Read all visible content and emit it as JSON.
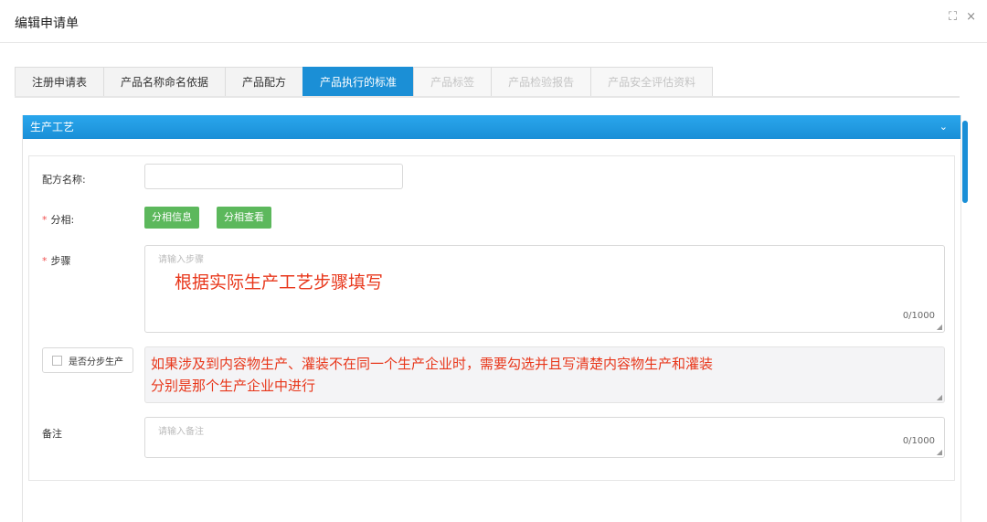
{
  "dialog": {
    "title": "编辑申请单",
    "fullscreen_icon": "⛶",
    "close_icon": "×"
  },
  "tabs": [
    {
      "label": "注册申请表",
      "state": "normal"
    },
    {
      "label": "产品名称命名依据",
      "state": "normal"
    },
    {
      "label": "产品配方",
      "state": "normal"
    },
    {
      "label": "产品执行的标准",
      "state": "active"
    },
    {
      "label": "产品标签",
      "state": "disabled"
    },
    {
      "label": "产品检验报告",
      "state": "disabled"
    },
    {
      "label": "产品安全评估资料",
      "state": "disabled"
    }
  ],
  "section": {
    "title": "生产工艺",
    "collapse_icon": "chevron-down-icon"
  },
  "form": {
    "formula_name_label": "配方名称:",
    "formula_name_value": "",
    "group_label": "分相:",
    "group_info_button": "分相信息",
    "group_view_button": "分相查看",
    "steps_label": "步骤",
    "steps_placeholder": "请输入步骤",
    "steps_counter": "0/1000",
    "split_checkbox_label": "是否分步生产",
    "notes_label": "备注",
    "notes_placeholder": "请输入备注",
    "notes_counter": "0/1000"
  },
  "annotations": {
    "steps_hint": "根据实际生产工艺步骤填写",
    "split_hint_line1": "如果涉及到内容物生产、灌装不在同一个生产企业时，需要勾选并且写清楚内容物生产和灌装",
    "split_hint_line2": "分别是那个生产企业中进行"
  },
  "colors": {
    "accent": "#1b8fd6",
    "button_green": "#5cb85c",
    "annotation_red": "#e8371b",
    "required_red": "#f05050"
  }
}
